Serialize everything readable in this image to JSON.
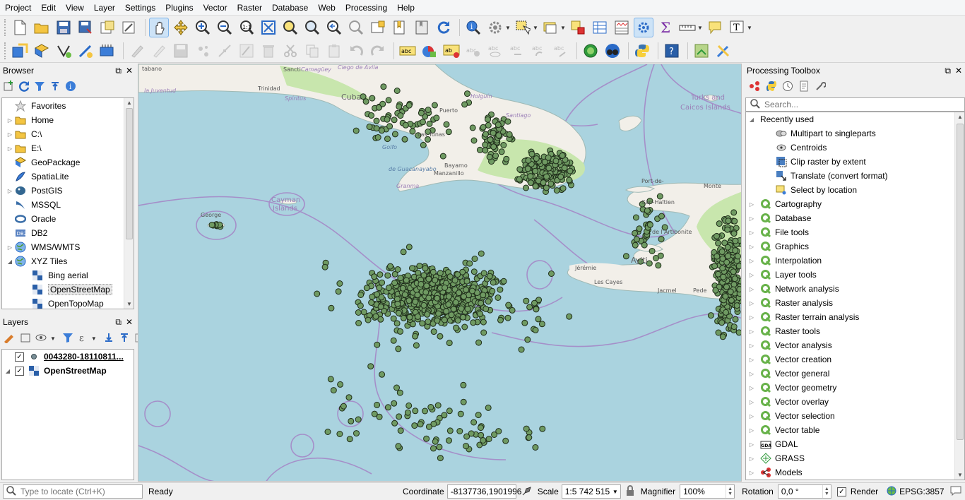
{
  "menu": [
    "Project",
    "Edit",
    "View",
    "Layer",
    "Settings",
    "Plugins",
    "Vector",
    "Raster",
    "Database",
    "Web",
    "Processing",
    "Help"
  ],
  "browser": {
    "title": "Browser",
    "items": [
      {
        "label": "Favorites",
        "icon": "star-icon",
        "expand": ""
      },
      {
        "label": "Home",
        "icon": "folder-icon",
        "expand": "▷"
      },
      {
        "label": "C:\\",
        "icon": "folder-icon",
        "expand": "▷"
      },
      {
        "label": "E:\\",
        "icon": "folder-icon",
        "expand": "▷"
      },
      {
        "label": "GeoPackage",
        "icon": "geopackage-icon",
        "expand": ""
      },
      {
        "label": "SpatiaLite",
        "icon": "spatialite-icon",
        "expand": ""
      },
      {
        "label": "PostGIS",
        "icon": "postgis-icon",
        "expand": "▷"
      },
      {
        "label": "MSSQL",
        "icon": "mssql-icon",
        "expand": ""
      },
      {
        "label": "Oracle",
        "icon": "oracle-icon",
        "expand": ""
      },
      {
        "label": "DB2",
        "icon": "db2-icon",
        "expand": ""
      },
      {
        "label": "WMS/WMTS",
        "icon": "globe-icon",
        "expand": "▷"
      },
      {
        "label": "XYZ Tiles",
        "icon": "globe-icon",
        "expand": "◢"
      },
      {
        "label": "Bing aerial",
        "icon": "tiles-icon",
        "expand": "",
        "indent": true
      },
      {
        "label": "OpenStreetMap",
        "icon": "tiles-icon",
        "expand": "",
        "indent": true,
        "selected": true
      },
      {
        "label": "OpenTopoMap",
        "icon": "tiles-icon",
        "expand": "",
        "indent": true
      }
    ]
  },
  "layers": {
    "title": "Layers",
    "items": [
      {
        "label": "0043280-18110811...",
        "checked": true,
        "icon": "point-layer-icon",
        "underline": true
      },
      {
        "label": "OpenStreetMap",
        "checked": true,
        "icon": "tiles-icon",
        "underline": false
      }
    ]
  },
  "map": {
    "labels": [
      {
        "text": "Cuba",
        "cls": "big"
      },
      {
        "text": "Cayman",
        "cls": "pink"
      },
      {
        "text": "Islands",
        "cls": "pink"
      },
      {
        "text": "Turks and",
        "cls": "pink"
      },
      {
        "text": "Caicos Islands",
        "cls": "pink"
      },
      {
        "text": "Ayiti",
        "cls": "big"
      },
      {
        "text": "George",
        "cls": "small"
      },
      {
        "text": "Bayamo",
        "cls": "small"
      },
      {
        "text": "Manzanillo",
        "cls": "small"
      },
      {
        "text": "Port-de-",
        "cls": "small"
      },
      {
        "text": "Cap-Haïtien",
        "cls": "small"
      },
      {
        "text": "Jacmel",
        "cls": "small"
      },
      {
        "text": "Les Cayes",
        "cls": "small"
      },
      {
        "text": "Monte",
        "cls": "small"
      },
      {
        "text": "Puerto",
        "cls": "small"
      },
      {
        "text": "Las Tunas",
        "cls": "small"
      },
      {
        "text": "Golfo",
        "cls": "sea"
      },
      {
        "text": "de Guacanayabo",
        "cls": "sea"
      },
      {
        "text": "Granma",
        "cls": "prov"
      },
      {
        "text": "Sancti",
        "cls": "small"
      },
      {
        "text": "Spíritus",
        "cls": "prov"
      },
      {
        "text": "Trinidad",
        "cls": "small"
      },
      {
        "text": "Ciego de Ávila",
        "cls": "prov"
      },
      {
        "text": "tabano",
        "cls": "small"
      },
      {
        "text": "la Juventud",
        "cls": "prov"
      },
      {
        "text": "Jérémie",
        "cls": "small"
      },
      {
        "text": "Pede",
        "cls": "small"
      },
      {
        "text": "de l'Artibonite",
        "cls": "small"
      },
      {
        "text": "Santiago",
        "cls": "prov"
      },
      {
        "text": "Camagüey",
        "cls": "prov"
      },
      {
        "text": "Holguín",
        "cls": "prov"
      }
    ]
  },
  "toolbox": {
    "title": "Processing Toolbox",
    "search_placeholder": "Search...",
    "recent_label": "Recently used",
    "recent": [
      {
        "label": "Multipart to singleparts",
        "icon": "multipart-icon"
      },
      {
        "label": "Centroids",
        "icon": "centroids-icon"
      },
      {
        "label": "Clip raster by extent",
        "icon": "clip-raster-icon"
      },
      {
        "label": "Translate (convert format)",
        "icon": "translate-icon"
      },
      {
        "label": "Select by location",
        "icon": "select-location-icon"
      }
    ],
    "groups": [
      {
        "label": "Cartography",
        "icon": "qgis-q-icon"
      },
      {
        "label": "Database",
        "icon": "qgis-q-icon"
      },
      {
        "label": "File tools",
        "icon": "qgis-q-icon"
      },
      {
        "label": "Graphics",
        "icon": "qgis-q-icon"
      },
      {
        "label": "Interpolation",
        "icon": "qgis-q-icon"
      },
      {
        "label": "Layer tools",
        "icon": "qgis-q-icon"
      },
      {
        "label": "Network analysis",
        "icon": "qgis-q-icon"
      },
      {
        "label": "Raster analysis",
        "icon": "qgis-q-icon"
      },
      {
        "label": "Raster terrain analysis",
        "icon": "qgis-q-icon"
      },
      {
        "label": "Raster tools",
        "icon": "qgis-q-icon"
      },
      {
        "label": "Vector analysis",
        "icon": "qgis-q-icon"
      },
      {
        "label": "Vector creation",
        "icon": "qgis-q-icon"
      },
      {
        "label": "Vector general",
        "icon": "qgis-q-icon"
      },
      {
        "label": "Vector geometry",
        "icon": "qgis-q-icon"
      },
      {
        "label": "Vector overlay",
        "icon": "qgis-q-icon"
      },
      {
        "label": "Vector selection",
        "icon": "qgis-q-icon"
      },
      {
        "label": "Vector table",
        "icon": "qgis-q-icon"
      },
      {
        "label": "GDAL",
        "icon": "gdal-icon"
      },
      {
        "label": "GRASS",
        "icon": "grass-icon"
      },
      {
        "label": "Models",
        "icon": "models-icon"
      }
    ]
  },
  "status": {
    "locate_placeholder": "Type to locate (Ctrl+K)",
    "message": "Ready",
    "coordinate_label": "Coordinate",
    "coordinate_value": "-8137736,1901996",
    "scale_label": "Scale",
    "scale_value": "1:5 742 515",
    "magnifier_label": "Magnifier",
    "magnifier_value": "100%",
    "rotation_label": "Rotation",
    "rotation_value": "0,0 °",
    "render_label": "Render",
    "render_checked": true,
    "crs": "EPSG:3857"
  },
  "colors": {
    "sea": "#aad3df",
    "land": "#f2efe9",
    "green_land": "#c8e6ad",
    "point_fill": "#6f9a62",
    "point_stroke": "#1f2d1a",
    "boundary": "#a58fc9"
  }
}
